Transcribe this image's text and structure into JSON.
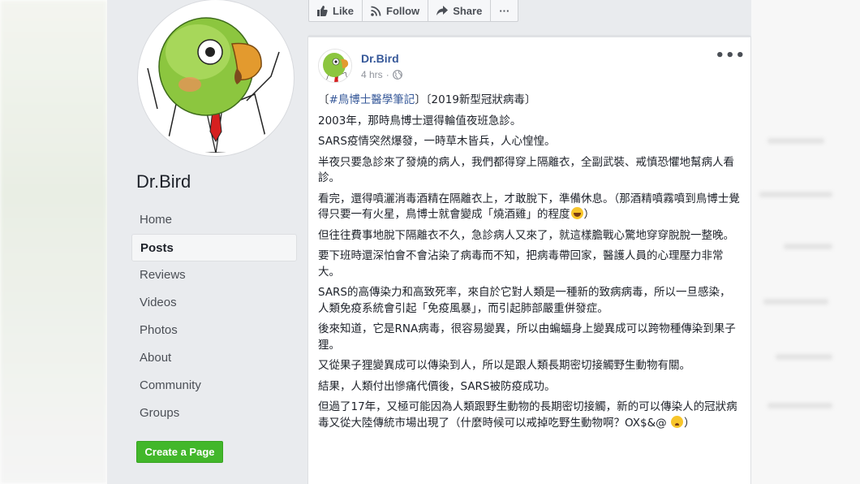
{
  "page": {
    "name": "Dr.Bird"
  },
  "nav": {
    "items": [
      {
        "label": "Home",
        "active": false
      },
      {
        "label": "Posts",
        "active": true
      },
      {
        "label": "Reviews",
        "active": false
      },
      {
        "label": "Videos",
        "active": false
      },
      {
        "label": "Photos",
        "active": false
      },
      {
        "label": "About",
        "active": false
      },
      {
        "label": "Community",
        "active": false
      },
      {
        "label": "Groups",
        "active": false
      }
    ],
    "create_page_label": "Create a Page"
  },
  "action_bar": {
    "like_label": "Like",
    "follow_label": "Follow",
    "share_label": "Share",
    "more_label": "···"
  },
  "post": {
    "author": "Dr.Bird",
    "time": "4 hrs",
    "visibility_icon": "globe-icon",
    "more_label": "•••",
    "tag_open": "〔",
    "hashtag": "#鳥博士醫學筆記",
    "tag_rest": "〕〔2019新型冠狀病毒〕",
    "p1": "2003年，那時鳥博士還得輪值夜班急診。",
    "p2": "SARS疫情突然爆發，一時草木皆兵，人心惶惶。",
    "p3": "半夜只要急診來了發燒的病人，我們都得穿上隔離衣，全副武裝、戒慎恐懼地幫病人看診。",
    "p4a": "看完，還得噴灑消毒酒精在隔離衣上，才敢脫下，準備休息。（那酒精噴霧噴到鳥博士覺得只要一有火星，鳥博士就會變成「燒酒雞」的程度",
    "p4b": "）",
    "p5": "但往往費事地脫下隔離衣不久，急診病人又來了，就這樣膽戰心驚地穿穿脫脫一整晚。",
    "p6": "要下班時還深怕會不會沾染了病毒而不知，把病毒帶回家，醫護人員的心理壓力非常大。",
    "p7": "SARS的高傳染力和高致死率，來自於它對人類是一種新的致病病毒，所以一旦感染，人類免疫系統會引起「免疫風暴」，而引起肺部嚴重併發症。",
    "p8": "後來知道，它是RNA病毒，很容易變異，所以由蝙蝠身上變異成可以跨物種傳染到果子狸。",
    "p9": "又從果子狸變異成可以傳染到人，所以是跟人類長期密切接觸野生動物有關。",
    "p10": "結果，人類付出慘痛代價後，SARS被防疫成功。",
    "p11a": "但過了17年，又極可能因為人類跟野生動物的長期密切接觸，新的可以傳染人的冠狀病毒又從大陸傳統市場出現了（什麼時候可以戒掉吃野生動物啊？OX$&@",
    "p11b": "）"
  },
  "colors": {
    "link": "#365899",
    "green_button": "#42b72a",
    "page_bg": "#e9ebee"
  }
}
